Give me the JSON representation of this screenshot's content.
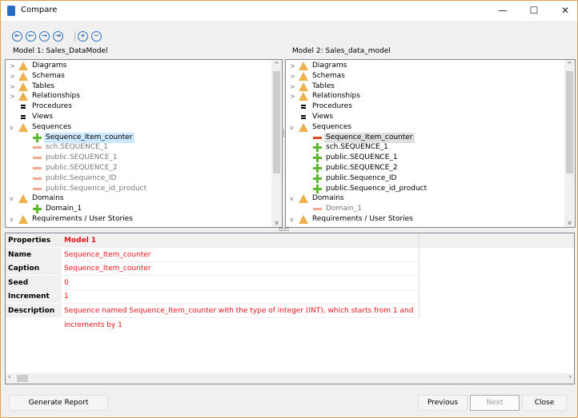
{
  "window": {
    "title": "Compare",
    "minimize": "—",
    "maximize": "☐",
    "close": "✕"
  },
  "toolbar": {
    "first": "⇤",
    "prev": "←",
    "next": "→",
    "last": "⇥",
    "expand": "+",
    "collapse": "−"
  },
  "model1": {
    "label": "Model 1: Sales_DataModel",
    "items": [
      {
        "label": "Diagrams",
        "icon": "warning",
        "exp": ">",
        "level": 0
      },
      {
        "label": "Schemas",
        "icon": "warning",
        "exp": ">",
        "level": 0
      },
      {
        "label": "Tables",
        "icon": "warning",
        "exp": ">",
        "level": 0
      },
      {
        "label": "Relationships",
        "icon": "warning",
        "exp": ">",
        "level": 0
      },
      {
        "label": "Procedures",
        "icon": "equal",
        "exp": "",
        "level": 0
      },
      {
        "label": "Views",
        "icon": "equal",
        "exp": "",
        "level": 0
      },
      {
        "label": "Sequences",
        "icon": "warning",
        "exp": "v",
        "level": 0
      },
      {
        "label": "Sequence_Item_counter",
        "icon": "added",
        "exp": "",
        "level": 1,
        "state": "selected"
      },
      {
        "label": "sch.SEQUENCE_1",
        "icon": "removed",
        "exp": "",
        "level": 1,
        "state": "missing"
      },
      {
        "label": "public.SEQUENCE_1",
        "icon": "removed",
        "exp": "",
        "level": 1,
        "state": "missing"
      },
      {
        "label": "public.SEQUENCE_2",
        "icon": "removed",
        "exp": "",
        "level": 1,
        "state": "missing"
      },
      {
        "label": "public.Sequence_ID",
        "icon": "removed",
        "exp": "",
        "level": 1,
        "state": "missing"
      },
      {
        "label": "public.Sequence_id_product",
        "icon": "removed",
        "exp": "",
        "level": 1,
        "state": "missing"
      },
      {
        "label": "Domains",
        "icon": "warning",
        "exp": "v",
        "level": 0
      },
      {
        "label": "Domain_1",
        "icon": "added",
        "exp": "",
        "level": 1
      },
      {
        "label": "Requirements / User Stories",
        "icon": "warning",
        "exp": "v",
        "level": 0
      }
    ]
  },
  "model2": {
    "label": "Model 2: Sales_data_model",
    "items": [
      {
        "label": "Diagrams",
        "icon": "warning",
        "exp": ">",
        "level": 0
      },
      {
        "label": "Schemas",
        "icon": "warning",
        "exp": ">",
        "level": 0
      },
      {
        "label": "Tables",
        "icon": "warning",
        "exp": ">",
        "level": 0
      },
      {
        "label": "Relationships",
        "icon": "warning",
        "exp": ">",
        "level": 0
      },
      {
        "label": "Procedures",
        "icon": "equal",
        "exp": "",
        "level": 0
      },
      {
        "label": "Views",
        "icon": "equal",
        "exp": "",
        "level": 0
      },
      {
        "label": "Sequences",
        "icon": "warning",
        "exp": "v",
        "level": 0
      },
      {
        "label": "Sequence_Item_counter",
        "icon": "removed-strong",
        "exp": "",
        "level": 1,
        "state": "selected-gray"
      },
      {
        "label": "sch.SEQUENCE_1",
        "icon": "added",
        "exp": "",
        "level": 1
      },
      {
        "label": "public.SEQUENCE_1",
        "icon": "added",
        "exp": "",
        "level": 1
      },
      {
        "label": "public.SEQUENCE_2",
        "icon": "added",
        "exp": "",
        "level": 1
      },
      {
        "label": "public.Sequence_ID",
        "icon": "added",
        "exp": "",
        "level": 1
      },
      {
        "label": "public.Sequence_id_product",
        "icon": "added",
        "exp": "",
        "level": 1
      },
      {
        "label": "Domains",
        "icon": "warning",
        "exp": "v",
        "level": 0
      },
      {
        "label": "Domain_1",
        "icon": "removed",
        "exp": "",
        "level": 1,
        "state": "missing"
      },
      {
        "label": "Requirements / User Stories",
        "icon": "warning",
        "exp": "v",
        "level": 0
      }
    ]
  },
  "properties": {
    "header": {
      "key": "Properties",
      "value": "Model 1"
    },
    "rows": [
      {
        "key": "Name",
        "value": "Sequence_Item_counter"
      },
      {
        "key": "Caption",
        "value": "Sequence_Item_counter"
      },
      {
        "key": "Seed",
        "value": "0"
      },
      {
        "key": "Increment",
        "value": "1"
      },
      {
        "key": "Description",
        "value": "Sequence named Sequence_Item_counter with the type of integer (INT), which starts from 1 and increments by 1"
      }
    ]
  },
  "buttons": {
    "report": "Generate Report",
    "previous": "Previous",
    "next": "Next",
    "close": "Close"
  },
  "colors": {
    "accent": "#2d6fc0",
    "diff_text": "#e8151b",
    "added": "#5cb82e",
    "removed": "#e04a20",
    "warning": "#f0b14a",
    "window_border": "#e2a24a"
  }
}
